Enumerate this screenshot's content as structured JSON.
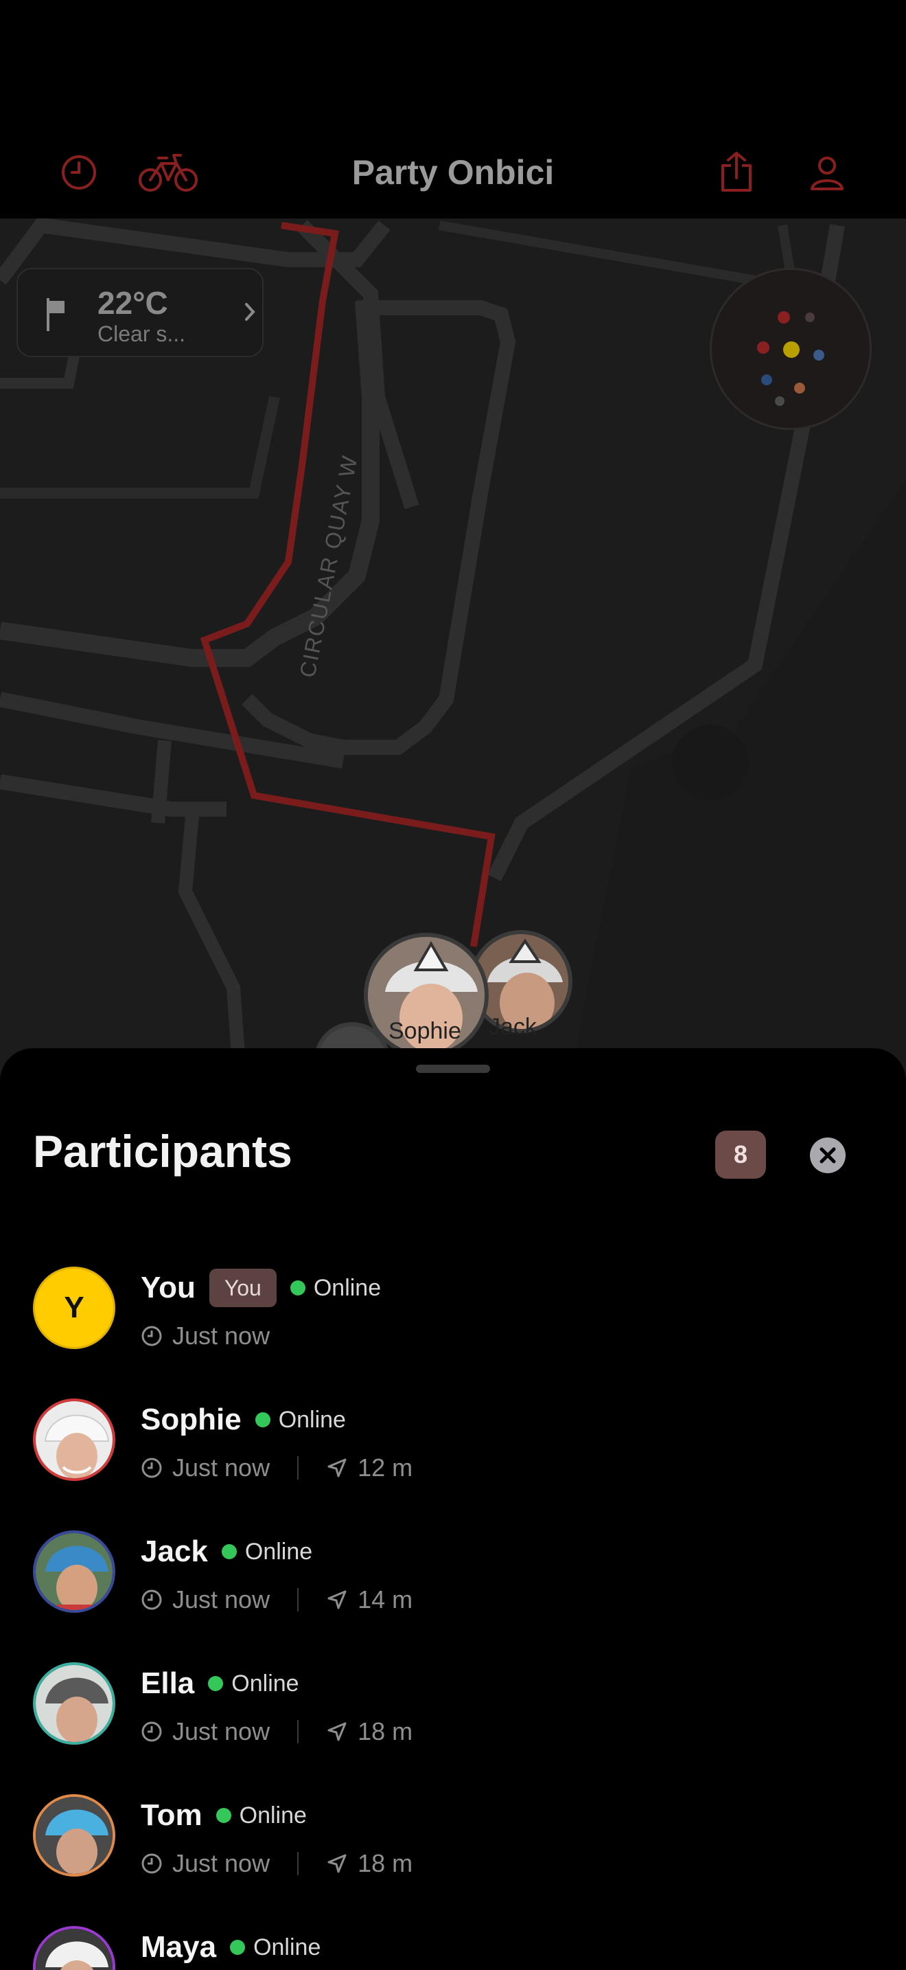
{
  "nav": {
    "title": "Party Onbici",
    "icons": [
      "clock-icon",
      "bicycle-icon",
      "share-icon",
      "person-icon"
    ]
  },
  "map": {
    "street_label": "CIRCULAR QUAY W",
    "weather": {
      "temperature": "22°C",
      "condition": "Clear s..."
    },
    "avatars": [
      {
        "name": "Sophie"
      },
      {
        "name": "Jack"
      }
    ],
    "colors": {
      "route": "#7a1c1c",
      "roads": "#2e2e2e",
      "background": "#1c1c1c"
    }
  },
  "sheet": {
    "title": "Participants",
    "count": "8",
    "participants": [
      {
        "name": "You",
        "badge": "You",
        "status": "Online",
        "time": "Just now",
        "distance": "",
        "initial": "Y",
        "ring": "#ffcc00"
      },
      {
        "name": "Sophie",
        "badge": "",
        "status": "Online",
        "time": "Just now",
        "distance": "12 m",
        "ring": "#d23a3a"
      },
      {
        "name": "Jack",
        "badge": "",
        "status": "Online",
        "time": "Just now",
        "distance": "14 m",
        "ring": "#3a4a9a"
      },
      {
        "name": "Ella",
        "badge": "",
        "status": "Online",
        "time": "Just now",
        "distance": "18 m",
        "ring": "#3ab0a0"
      },
      {
        "name": "Tom",
        "badge": "",
        "status": "Online",
        "time": "Just now",
        "distance": "18 m",
        "ring": "#e08a4a"
      },
      {
        "name": "Maya",
        "badge": "",
        "status": "Online",
        "time": "",
        "distance": "",
        "ring": "#9a3ad0"
      }
    ]
  }
}
